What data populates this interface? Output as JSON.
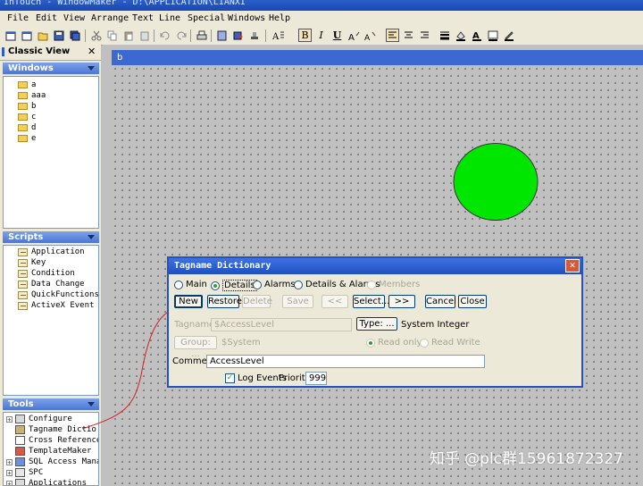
{
  "window": {
    "title": "InTouch - WindowMaker - D:\\APPLICATION\\LIANXI"
  },
  "menu": [
    "File",
    "Edit",
    "View",
    "Arrange",
    "Text",
    "Line",
    "Special",
    "Windows",
    "Help"
  ],
  "toolbar": {
    "bold": "B",
    "italic": "I",
    "underline": "U",
    "font_a": "A"
  },
  "classic_view": {
    "title": "Classic View",
    "close": "✕"
  },
  "windows_panel": {
    "title": "Windows",
    "items": [
      "a",
      "aaa",
      "b",
      "c",
      "d",
      "e"
    ]
  },
  "scripts_panel": {
    "title": "Scripts",
    "items": [
      "Application",
      "Key",
      "Condition",
      "Data Change",
      "QuickFunctions",
      "ActiveX Event"
    ]
  },
  "tools_panel": {
    "title": "Tools",
    "items": [
      "Configure",
      "Tagname Dictio",
      "Cross Reference",
      "TemplateMaker",
      "SQL Access Manag",
      "SPC",
      "Applications"
    ]
  },
  "canvas": {
    "tab_label": "b",
    "circle_color": "#00e600"
  },
  "dialog": {
    "title": "Tagname Dictionary",
    "close": "✕",
    "modes": [
      "Main",
      "Details",
      "Alarms",
      "Details & Alarms",
      "Members"
    ],
    "selected_mode": "Details",
    "buttons": {
      "new": "New",
      "restore": "Restore",
      "delete": "Delete",
      "save": "Save",
      "prev": "<<",
      "select": "Select...",
      "next": ">>",
      "cancel": "Cancel",
      "close": "Close"
    },
    "tagname_label": "Tagname:",
    "tagname_value": "$AccessLevel",
    "type_button": "Type: ...",
    "type_value": "System Integer",
    "group_button": "Group: ...",
    "group_value": "$System",
    "read_only": "Read only",
    "read_write": "Read Write",
    "comment_label": "Comment:",
    "comment_value": "AccessLevel",
    "log_events": "Log Events",
    "priority_label": "Priority:",
    "priority_value": "999"
  },
  "watermark": "知乎 @plc群15961872327"
}
